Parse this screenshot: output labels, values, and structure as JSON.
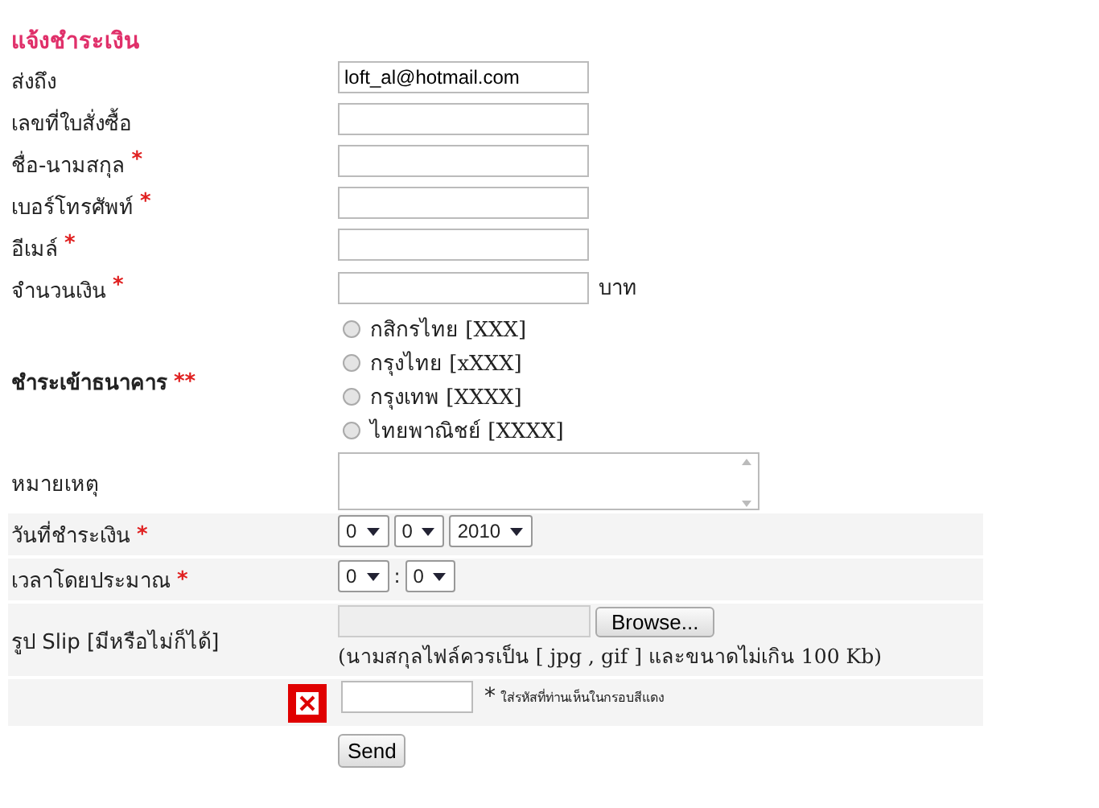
{
  "title": "แจ้งชำระเงิน",
  "fields": [
    {
      "kind": "text",
      "label": "ส่งถึง",
      "value": "loft_al@hotmail.com"
    },
    {
      "kind": "text",
      "label": "เลขที่ใบสั่งซื้อ"
    },
    {
      "kind": "text",
      "label": "ชื่อ-นามสกุล",
      "required": "*"
    },
    {
      "kind": "text",
      "label": "เบอร์โทรศัพท์",
      "required": "*"
    },
    {
      "kind": "text",
      "label": "อีเมล์",
      "required": "*"
    },
    {
      "kind": "amount",
      "label": "จำนวนเงิน",
      "required": "*",
      "unit": "บาท"
    },
    {
      "kind": "radio",
      "label": "ชำระเข้าธนาคาร",
      "required": "**",
      "options": [
        {
          "label": "กสิกรไทย [XXX]",
          "selected": false
        },
        {
          "label": "กรุงไทย [xXXX]",
          "selected": false
        },
        {
          "label": "กรุงเทพ [XXXX]",
          "selected": false
        },
        {
          "label": "ไทยพาณิชย์ [XXXX]",
          "selected": false
        }
      ]
    },
    {
      "kind": "textarea",
      "label": "หมายเหตุ"
    },
    {
      "kind": "selects",
      "label": "วันที่ชำระเงิน",
      "required": "*",
      "selects": [
        {
          "value": "0"
        },
        {
          "value": "0"
        },
        {
          "value": "2010"
        }
      ]
    },
    {
      "kind": "selects",
      "label": "เวลาโดยประมาณ",
      "required": "*",
      "separator": ":",
      "selects": [
        {
          "value": "0"
        },
        {
          "value": "0"
        }
      ]
    },
    {
      "kind": "file",
      "label": "รูป Slip [มีหรือไม่ก็ได้]",
      "button": "Browse...",
      "note": "(นามสกุลไฟล์ควรเป็น [ jpg , gif ] และขนาดไม่เกิน 100 Kb)"
    },
    {
      "kind": "captcha",
      "mark": "*",
      "hint": "ใส่รหัสที่ท่านเห็นในกรอบสีแดง"
    }
  ],
  "submit": "Send"
}
